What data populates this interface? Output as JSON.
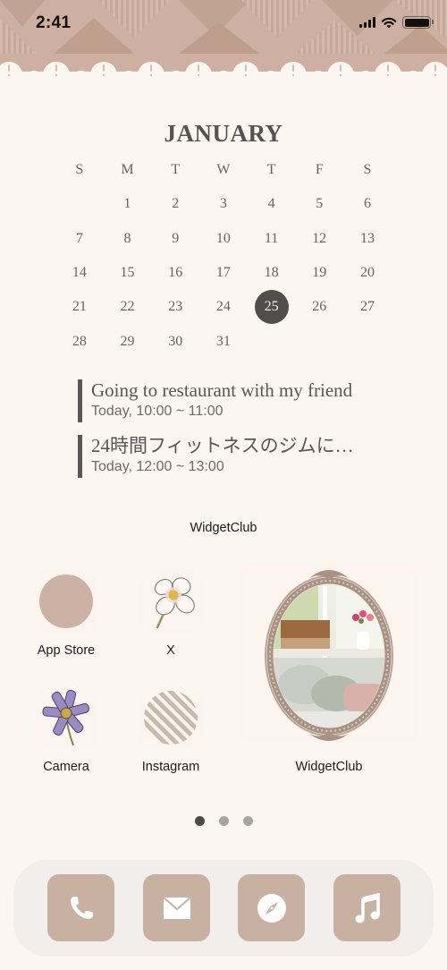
{
  "status_bar": {
    "time": "2:41",
    "icons": [
      "cellular-signal-icon",
      "wifi-icon",
      "battery-icon"
    ]
  },
  "calendar": {
    "month": "JANUARY",
    "weekdays": [
      "S",
      "M",
      "T",
      "W",
      "T",
      "F",
      "S"
    ],
    "weeks": [
      [
        "",
        "1",
        "2",
        "3",
        "4",
        "5",
        "6"
      ],
      [
        "7",
        "8",
        "9",
        "10",
        "11",
        "12",
        "13"
      ],
      [
        "14",
        "15",
        "16",
        "17",
        "18",
        "19",
        "20"
      ],
      [
        "21",
        "22",
        "23",
        "24",
        "25",
        "26",
        "27"
      ],
      [
        "28",
        "29",
        "30",
        "31",
        "",
        "",
        ""
      ]
    ],
    "today": "25"
  },
  "events": [
    {
      "title": "Going to restaurant with my friend",
      "time": "Today, 10:00 ~ 11:00"
    },
    {
      "title": "24時間フィットネスのジムに…",
      "time": "Today, 12:00 ~ 13:00"
    }
  ],
  "widget_label": "WidgetClub",
  "apps": [
    {
      "label": "App Store",
      "icon": "beige-circle-icon"
    },
    {
      "label": "X",
      "icon": "white-flower-icon"
    },
    {
      "label": "Camera",
      "icon": "purple-flower-icon"
    },
    {
      "label": "Instagram",
      "icon": "striped-circle-icon"
    }
  ],
  "photo_widget": {
    "label": "WidgetClub",
    "image": "ornate-oval-frame-bedroom-photo"
  },
  "page_indicator": {
    "count": 3,
    "active": 0
  },
  "dock": [
    {
      "name": "Phone",
      "icon": "phone-icon"
    },
    {
      "name": "Mail",
      "icon": "mail-icon"
    },
    {
      "name": "Safari",
      "icon": "compass-icon"
    },
    {
      "name": "Music",
      "icon": "music-note-icon"
    }
  ],
  "colors": {
    "background": "#fcf6f1",
    "header_pattern": "#c9ab9c",
    "accent_beige": "#c9b1a1",
    "today_circle": "#4f4e4c",
    "text_dark": "#5b5654"
  }
}
